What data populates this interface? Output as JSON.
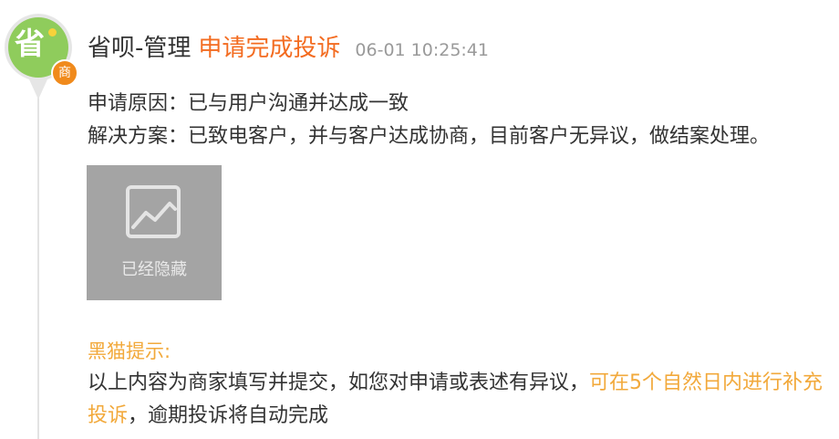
{
  "avatar": {
    "char": "省",
    "badge": "商"
  },
  "header": {
    "author": "省呗-管理",
    "action": "申请完成投诉",
    "time": "06-01 10:25:41"
  },
  "reason": "申请原因：已与用户沟通并达成一致",
  "solution": "解决方案：已致电客户，并与客户达成协商，目前客户无异议，做结案处理。",
  "attachment": {
    "label": "已经隐藏"
  },
  "tip": {
    "title": "黑猫提示:",
    "text_before": "以上内容为商家填写并提交，如您对申请或表述有异议，",
    "highlight": "可在5个自然日内进行补充投诉",
    "text_after": "，逾期投诉将自动完成"
  },
  "colors": {
    "action_orange": "#f36c21",
    "tip_orange": "#f2a93b",
    "avatar_green": "#8fcc5c",
    "badge_orange": "#f08a1c"
  }
}
